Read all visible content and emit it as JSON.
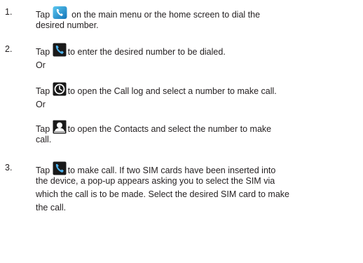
{
  "steps": [
    {
      "number": "1.",
      "lines": [
        {
          "pre": "Tap ",
          "icon": "phone-app-icon",
          "post": " on the main menu or the home screen to dial the"
        },
        {
          "text": "desired number."
        }
      ]
    },
    {
      "number": "2.",
      "lines": [
        {
          "pre": "Tap ",
          "icon": "phone-dialer-icon",
          "post": "to enter the desired number to be dialed."
        },
        {
          "text": "Or"
        },
        {
          "pre": "Tap ",
          "icon": "call-log-clock-icon",
          "post": "to open the Call log and select a number to make call."
        },
        {
          "text": "Or"
        },
        {
          "pre": "Tap ",
          "icon": "contacts-person-icon",
          "post": "to open the Contacts and select the number to make"
        },
        {
          "text": "call."
        }
      ]
    },
    {
      "number": "3.",
      "lines": [
        {
          "pre": "Tap ",
          "icon": "make-call-phone-icon",
          "post": "to make call. If two SIM cards have been inserted into"
        },
        {
          "text": "the device, a pop-up appears asking you to select the SIM via"
        },
        {
          "text": "which the call is to be made. Select the desired SIM card to make"
        },
        {
          "text": "the call."
        }
      ]
    }
  ]
}
